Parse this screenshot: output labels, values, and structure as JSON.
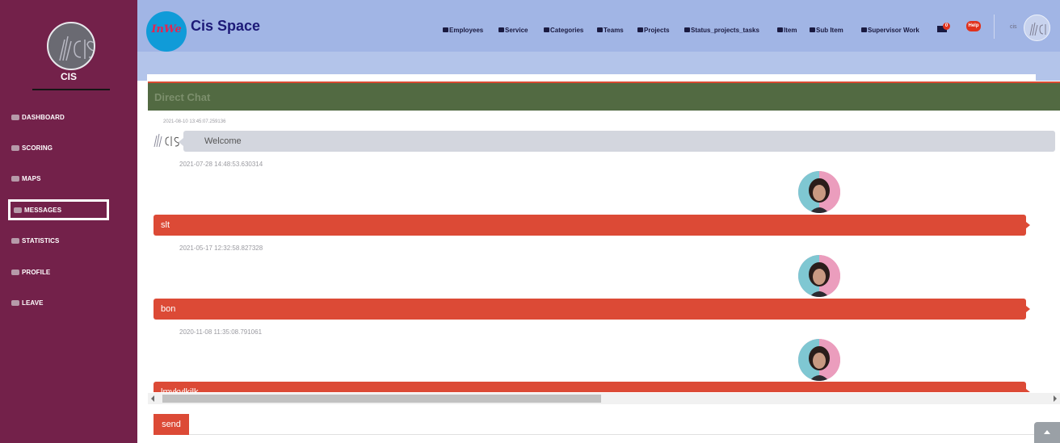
{
  "sidebar": {
    "brand": "CIS",
    "items": [
      {
        "label": "DASHBOARD",
        "icon": "dashboard-icon"
      },
      {
        "label": "SCORING",
        "icon": "scoring-icon"
      },
      {
        "label": "MAPS",
        "icon": "maps-icon"
      },
      {
        "label": "MESSAGES",
        "icon": "messages-icon",
        "active": true
      },
      {
        "label": "STATISTICS",
        "icon": "statistics-icon"
      },
      {
        "label": "PROFILE",
        "icon": "profile-icon"
      },
      {
        "label": "LEAVE",
        "icon": "leave-icon"
      }
    ]
  },
  "header": {
    "badge_text": "InWe",
    "title": "Cis Space",
    "nav": [
      {
        "label": "Employees",
        "icon": "user-icon"
      },
      {
        "label": "Service",
        "icon": "table-icon"
      },
      {
        "label": "Categories",
        "icon": "folder-icon"
      },
      {
        "label": "Teams",
        "icon": "table-icon"
      },
      {
        "label": "Projects",
        "icon": "car-icon"
      },
      {
        "label": "Status_projects_tasks",
        "icon": "car-icon"
      },
      {
        "label": "Item",
        "icon": "window-icon"
      },
      {
        "label": "Sub Item",
        "icon": "window-icon"
      },
      {
        "label": "Supervisor Work",
        "icon": "user-icon"
      }
    ],
    "notification_count": "0",
    "help_label": "Help",
    "user_name": "cis"
  },
  "chat": {
    "title": "Direct Chat",
    "incoming": {
      "date": "2021-08-10 13:45:07.259136",
      "text": "Welcome"
    },
    "outgoing": [
      {
        "date": "2021-07-28 14:48:53.630314",
        "text": "slt"
      },
      {
        "date": "2021-05-17 12:32:58.827328",
        "text": "bon"
      },
      {
        "date": "2020-11-08 11:35:08.791061",
        "text": "lmvkvlkilk"
      }
    ],
    "send_label": "send"
  },
  "colors": {
    "sidebar_bg": "#73214a",
    "topbar_bg": "#a1b5e5",
    "chat_header_bg": "#526a42",
    "accent": "#dc4a36",
    "incoming_bubble": "#d3d6de"
  }
}
